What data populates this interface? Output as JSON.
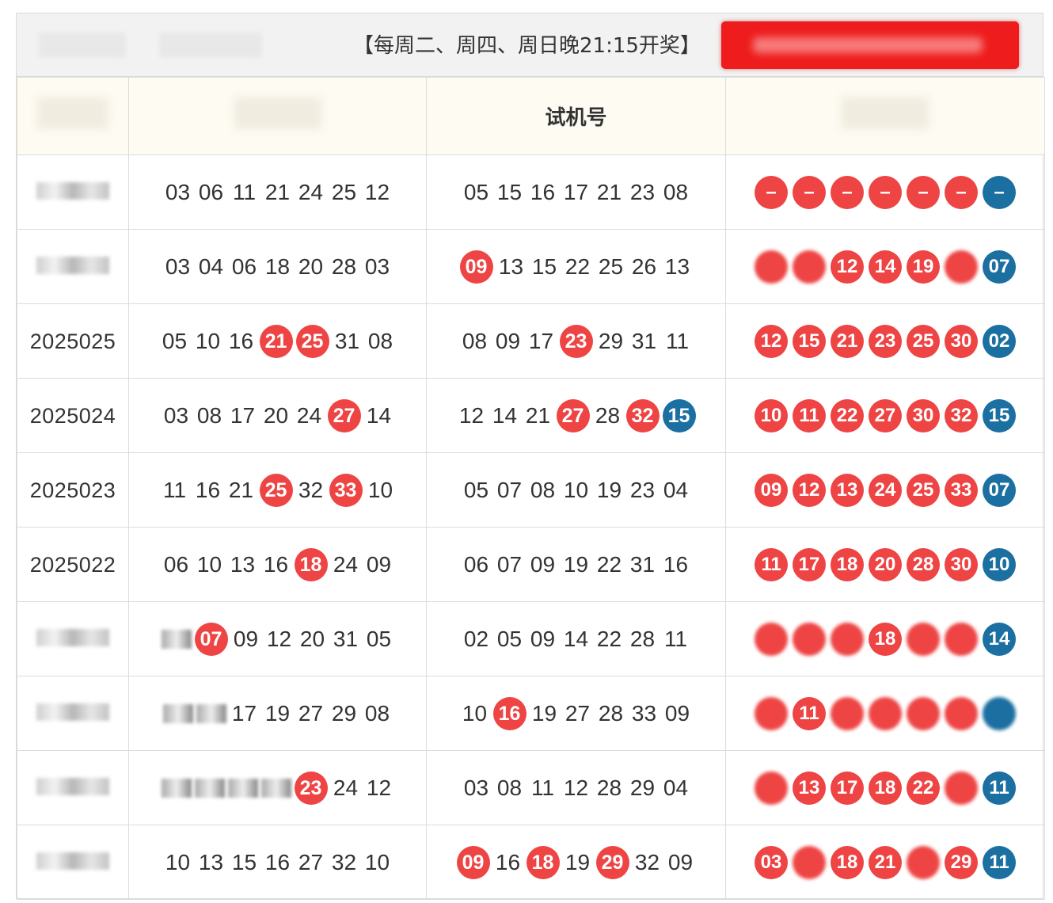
{
  "header": {
    "schedule_text": "【每周二、周四、周日晚21:15开奖】"
  },
  "columns": {
    "trial": "试机号"
  },
  "rows": [
    {
      "period": "",
      "draw": [
        {
          "v": "03"
        },
        {
          "v": "06"
        },
        {
          "v": "11"
        },
        {
          "v": "21"
        },
        {
          "v": "24"
        },
        {
          "v": "25"
        },
        {
          "v": "12"
        }
      ],
      "trial": [
        {
          "v": "05"
        },
        {
          "v": "15"
        },
        {
          "v": "16"
        },
        {
          "v": "17"
        },
        {
          "v": "21"
        },
        {
          "v": "23"
        },
        {
          "v": "08"
        }
      ],
      "prize": [
        {
          "v": "–",
          "c": "red"
        },
        {
          "v": "–",
          "c": "red"
        },
        {
          "v": "–",
          "c": "red"
        },
        {
          "v": "–",
          "c": "red"
        },
        {
          "v": "–",
          "c": "red"
        },
        {
          "v": "–",
          "c": "red"
        },
        {
          "v": "–",
          "c": "blue"
        }
      ]
    },
    {
      "period": "",
      "draw": [
        {
          "v": "03"
        },
        {
          "v": "04"
        },
        {
          "v": "06"
        },
        {
          "v": "18"
        },
        {
          "v": "20"
        },
        {
          "v": "28"
        },
        {
          "v": "03"
        }
      ],
      "trial": [
        {
          "v": "09",
          "c": "red"
        },
        {
          "v": "13"
        },
        {
          "v": "15"
        },
        {
          "v": "22"
        },
        {
          "v": "25"
        },
        {
          "v": "26"
        },
        {
          "v": "13"
        }
      ],
      "prize": [
        {
          "v": "",
          "c": "red",
          "blur": true
        },
        {
          "v": "",
          "c": "red",
          "blur": true
        },
        {
          "v": "12",
          "c": "red"
        },
        {
          "v": "14",
          "c": "red"
        },
        {
          "v": "19",
          "c": "red"
        },
        {
          "v": "",
          "c": "red",
          "blur": true
        },
        {
          "v": "07",
          "c": "blue"
        }
      ]
    },
    {
      "period": "2025025",
      "draw": [
        {
          "v": "05"
        },
        {
          "v": "10"
        },
        {
          "v": "16"
        },
        {
          "v": "21",
          "c": "red"
        },
        {
          "v": "25",
          "c": "red"
        },
        {
          "v": "31"
        },
        {
          "v": "08"
        }
      ],
      "trial": [
        {
          "v": "08"
        },
        {
          "v": "09"
        },
        {
          "v": "17"
        },
        {
          "v": "23",
          "c": "red"
        },
        {
          "v": "29"
        },
        {
          "v": "31"
        },
        {
          "v": "11"
        }
      ],
      "prize": [
        {
          "v": "12",
          "c": "red"
        },
        {
          "v": "15",
          "c": "red"
        },
        {
          "v": "21",
          "c": "red"
        },
        {
          "v": "23",
          "c": "red"
        },
        {
          "v": "25",
          "c": "red"
        },
        {
          "v": "30",
          "c": "red"
        },
        {
          "v": "02",
          "c": "blue"
        }
      ]
    },
    {
      "period": "2025024",
      "draw": [
        {
          "v": "03"
        },
        {
          "v": "08"
        },
        {
          "v": "17"
        },
        {
          "v": "20"
        },
        {
          "v": "24"
        },
        {
          "v": "27",
          "c": "red"
        },
        {
          "v": "14"
        }
      ],
      "trial": [
        {
          "v": "12"
        },
        {
          "v": "14"
        },
        {
          "v": "21"
        },
        {
          "v": "27",
          "c": "red"
        },
        {
          "v": "28"
        },
        {
          "v": "32",
          "c": "red"
        },
        {
          "v": "15",
          "c": "blue"
        }
      ],
      "prize": [
        {
          "v": "10",
          "c": "red"
        },
        {
          "v": "11",
          "c": "red"
        },
        {
          "v": "22",
          "c": "red"
        },
        {
          "v": "27",
          "c": "red"
        },
        {
          "v": "30",
          "c": "red"
        },
        {
          "v": "32",
          "c": "red"
        },
        {
          "v": "15",
          "c": "blue"
        }
      ]
    },
    {
      "period": "2025023",
      "draw": [
        {
          "v": "11"
        },
        {
          "v": "16"
        },
        {
          "v": "21"
        },
        {
          "v": "25",
          "c": "red"
        },
        {
          "v": "32"
        },
        {
          "v": "33",
          "c": "red"
        },
        {
          "v": "10"
        }
      ],
      "trial": [
        {
          "v": "05"
        },
        {
          "v": "07"
        },
        {
          "v": "08"
        },
        {
          "v": "10"
        },
        {
          "v": "19"
        },
        {
          "v": "23"
        },
        {
          "v": "04"
        }
      ],
      "prize": [
        {
          "v": "09",
          "c": "red"
        },
        {
          "v": "12",
          "c": "red"
        },
        {
          "v": "13",
          "c": "red"
        },
        {
          "v": "24",
          "c": "red"
        },
        {
          "v": "25",
          "c": "red"
        },
        {
          "v": "33",
          "c": "red"
        },
        {
          "v": "07",
          "c": "blue"
        }
      ]
    },
    {
      "period": "2025022",
      "draw": [
        {
          "v": "06"
        },
        {
          "v": "10"
        },
        {
          "v": "13"
        },
        {
          "v": "16"
        },
        {
          "v": "18",
          "c": "red"
        },
        {
          "v": "24"
        },
        {
          "v": "09"
        }
      ],
      "trial": [
        {
          "v": "06"
        },
        {
          "v": "07"
        },
        {
          "v": "09"
        },
        {
          "v": "19"
        },
        {
          "v": "22"
        },
        {
          "v": "31"
        },
        {
          "v": "16"
        }
      ],
      "prize": [
        {
          "v": "11",
          "c": "red"
        },
        {
          "v": "17",
          "c": "red"
        },
        {
          "v": "18",
          "c": "red"
        },
        {
          "v": "20",
          "c": "red"
        },
        {
          "v": "28",
          "c": "red"
        },
        {
          "v": "30",
          "c": "red"
        },
        {
          "v": "10",
          "c": "blue"
        }
      ]
    },
    {
      "period": "",
      "draw": [
        {
          "v": "",
          "blur": true
        },
        {
          "v": "07",
          "c": "red"
        },
        {
          "v": "09"
        },
        {
          "v": "12"
        },
        {
          "v": "20"
        },
        {
          "v": "31"
        },
        {
          "v": "05"
        }
      ],
      "trial": [
        {
          "v": "02"
        },
        {
          "v": "05"
        },
        {
          "v": "09"
        },
        {
          "v": "14"
        },
        {
          "v": "22"
        },
        {
          "v": "28"
        },
        {
          "v": "11"
        }
      ],
      "prize": [
        {
          "v": "",
          "c": "red",
          "blur": true
        },
        {
          "v": "",
          "c": "red",
          "blur": true
        },
        {
          "v": "",
          "c": "red",
          "blur": true
        },
        {
          "v": "18",
          "c": "red"
        },
        {
          "v": "",
          "c": "red",
          "blur": true
        },
        {
          "v": "",
          "c": "red",
          "blur": true
        },
        {
          "v": "14",
          "c": "blue"
        }
      ]
    },
    {
      "period": "",
      "draw": [
        {
          "v": "",
          "blur": true
        },
        {
          "v": "",
          "blur": true
        },
        {
          "v": "17"
        },
        {
          "v": "19"
        },
        {
          "v": "27"
        },
        {
          "v": "29"
        },
        {
          "v": "08"
        }
      ],
      "trial": [
        {
          "v": "10"
        },
        {
          "v": "16",
          "c": "red"
        },
        {
          "v": "19"
        },
        {
          "v": "27"
        },
        {
          "v": "28"
        },
        {
          "v": "33"
        },
        {
          "v": "09"
        }
      ],
      "prize": [
        {
          "v": "",
          "c": "red",
          "blur": true
        },
        {
          "v": "11",
          "c": "red"
        },
        {
          "v": "",
          "c": "red",
          "blur": true
        },
        {
          "v": "",
          "c": "red",
          "blur": true
        },
        {
          "v": "",
          "c": "red",
          "blur": true
        },
        {
          "v": "",
          "c": "red",
          "blur": true
        },
        {
          "v": "",
          "c": "blue",
          "blur": true
        }
      ]
    },
    {
      "period": "",
      "draw": [
        {
          "v": "",
          "blur": true
        },
        {
          "v": "",
          "blur": true
        },
        {
          "v": "",
          "blur": true
        },
        {
          "v": "",
          "blur": true
        },
        {
          "v": "23",
          "c": "red"
        },
        {
          "v": "24"
        },
        {
          "v": "12"
        }
      ],
      "trial": [
        {
          "v": "03"
        },
        {
          "v": "08"
        },
        {
          "v": "11"
        },
        {
          "v": "12"
        },
        {
          "v": "28"
        },
        {
          "v": "29"
        },
        {
          "v": "04"
        }
      ],
      "prize": [
        {
          "v": "",
          "c": "red",
          "blur": true
        },
        {
          "v": "13",
          "c": "red"
        },
        {
          "v": "17",
          "c": "red"
        },
        {
          "v": "18",
          "c": "red"
        },
        {
          "v": "22",
          "c": "red"
        },
        {
          "v": "",
          "c": "red",
          "blur": true
        },
        {
          "v": "11",
          "c": "blue"
        }
      ]
    },
    {
      "period": "",
      "draw": [
        {
          "v": "10"
        },
        {
          "v": "13"
        },
        {
          "v": "15"
        },
        {
          "v": "16"
        },
        {
          "v": "27"
        },
        {
          "v": "32"
        },
        {
          "v": "10"
        }
      ],
      "trial": [
        {
          "v": "09",
          "c": "red"
        },
        {
          "v": "16"
        },
        {
          "v": "18",
          "c": "red"
        },
        {
          "v": "19"
        },
        {
          "v": "29",
          "c": "red"
        },
        {
          "v": "32"
        },
        {
          "v": "09"
        }
      ],
      "prize": [
        {
          "v": "03",
          "c": "red"
        },
        {
          "v": "",
          "c": "red",
          "blur": true
        },
        {
          "v": "18",
          "c": "red"
        },
        {
          "v": "21",
          "c": "red"
        },
        {
          "v": "",
          "c": "red",
          "blur": true
        },
        {
          "v": "29",
          "c": "red"
        },
        {
          "v": "11",
          "c": "blue"
        }
      ]
    }
  ],
  "colors": {
    "red": "#ee4444",
    "blue": "#1b6fa1",
    "button_red": "#ee1c1c"
  }
}
